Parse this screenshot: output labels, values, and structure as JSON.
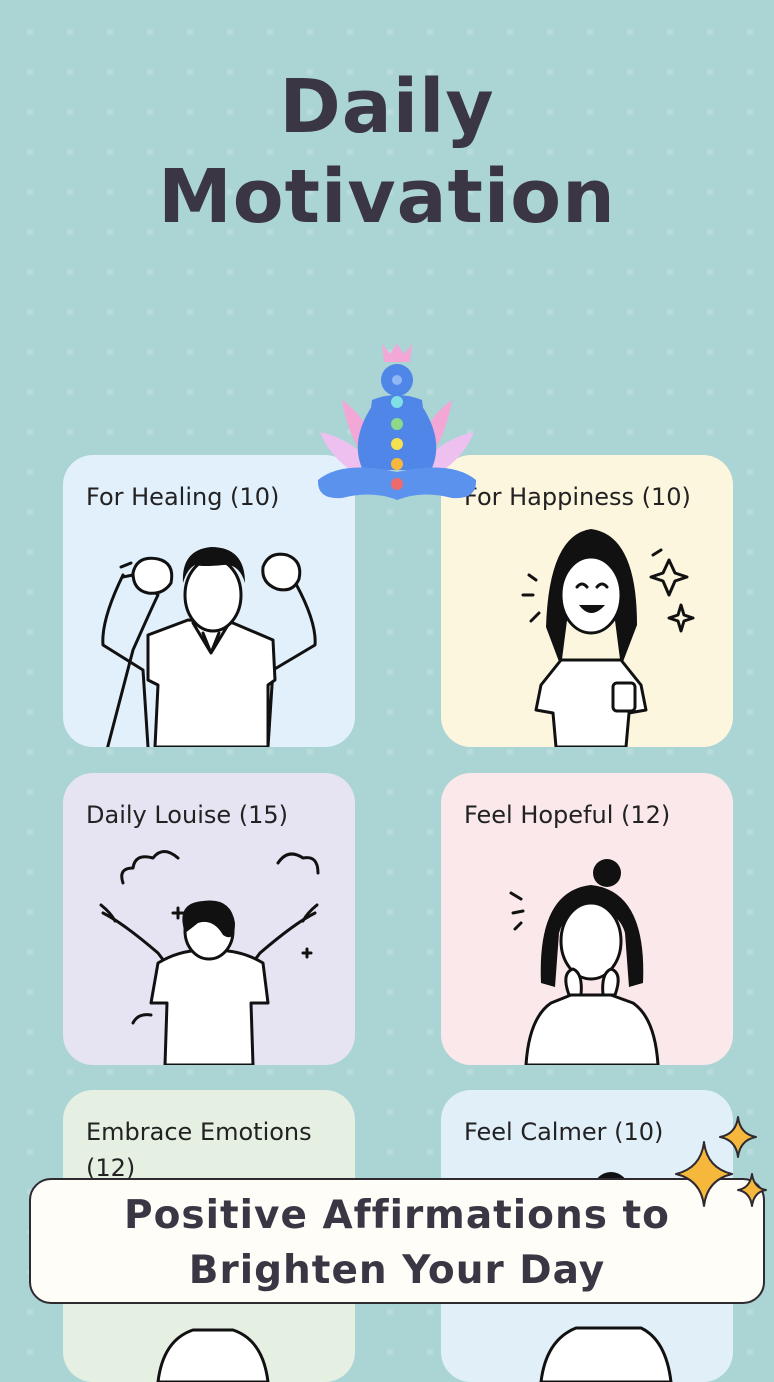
{
  "header": {
    "title_line1": "Daily",
    "title_line2": "Motivation"
  },
  "hero_icon": "meditation-chakra-icon",
  "categories": [
    {
      "label": "For Healing (10)",
      "illustration": "man-raising-fists",
      "color": "#e2f0fb"
    },
    {
      "label": "For Happiness (10)",
      "illustration": "laughing-girl",
      "color": "#fdf6df"
    },
    {
      "label": "Daily Louise (15)",
      "illustration": "boy-arms-outstretched",
      "color": "#e6e4f2"
    },
    {
      "label": "Feel Hopeful (12)",
      "illustration": "hopeful-girl",
      "color": "#fae8ea"
    },
    {
      "label": "Embrace Emotions (12)",
      "illustration": "person-embracing",
      "color": "#e5f0e3"
    },
    {
      "label": "Feel Calmer (10)",
      "illustration": "calm-person",
      "color": "#e0eff8"
    }
  ],
  "banner": {
    "line1": "Positive Affirmations to",
    "line2": "Brighten Your Day"
  },
  "decor": {
    "sparkles_icon": "sparkles-icon",
    "accent": "#f5b83d"
  }
}
